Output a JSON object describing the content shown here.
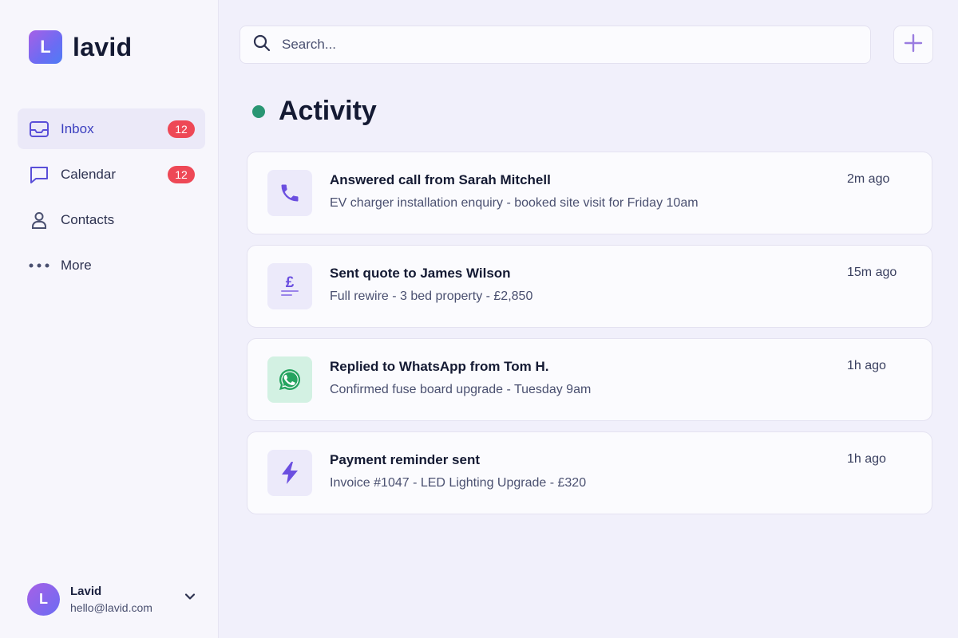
{
  "brand": {
    "logo_letter": "L",
    "name": "lavid"
  },
  "nav": {
    "items": [
      {
        "label": "Inbox",
        "icon": "inbox-icon",
        "badge": "12",
        "active": true
      },
      {
        "label": "Calendar",
        "icon": "chat-icon",
        "badge": "12",
        "active": false
      },
      {
        "label": "Contacts",
        "icon": "person-icon",
        "badge": null,
        "active": false
      },
      {
        "label": "More",
        "icon": "more-icon",
        "badge": null,
        "active": false
      }
    ]
  },
  "user": {
    "initial": "L",
    "name": "Lavid",
    "email": "hello@lavid.com"
  },
  "search": {
    "placeholder": "Search..."
  },
  "heading": {
    "title": "Activity",
    "status_color": "#2a9673"
  },
  "activity": [
    {
      "icon": "phone-icon",
      "title": "Answered call from Sarah Mitchell",
      "description": "EV charger installation enquiry - booked site visit for Friday 10am",
      "time": "2m ago"
    },
    {
      "icon": "pound-icon",
      "title": "Sent quote to James Wilson",
      "description": "Full rewire - 3 bed property - £2,850",
      "time": "15m ago"
    },
    {
      "icon": "whatsapp-icon",
      "title": "Replied to WhatsApp from Tom H.",
      "description": "Confirmed fuse board upgrade - Tuesday 9am",
      "time": "1h ago"
    },
    {
      "icon": "lightning-icon",
      "title": "Payment reminder sent",
      "description": "Invoice #1047 - LED Lighting Upgrade - £320",
      "time": "1h ago"
    }
  ],
  "colors": {
    "accent": "#6b5be6",
    "badge": "#ee4856",
    "whatsapp": "#25a35f"
  }
}
